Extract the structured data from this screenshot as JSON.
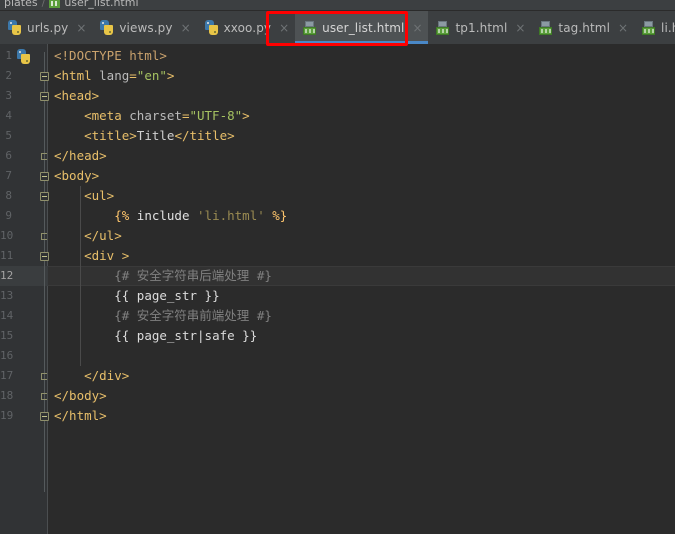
{
  "breadcrumb": {
    "path_text": "plates",
    "separator": "/",
    "file": "user_list.html",
    "file_icon": "html-file-icon"
  },
  "tabs": {
    "close_glyph": "×",
    "items": [
      {
        "label": "urls.py",
        "icon": "python-file-icon",
        "active": false
      },
      {
        "label": "views.py",
        "icon": "python-file-icon",
        "active": false
      },
      {
        "label": "xxoo.py",
        "icon": "python-file-icon",
        "active": false
      },
      {
        "label": "user_list.html",
        "icon": "html-file-icon",
        "active": true
      },
      {
        "label": "tp1.html",
        "icon": "html-file-icon",
        "active": false
      },
      {
        "label": "tag.html",
        "icon": "html-file-icon",
        "active": false
      },
      {
        "label": "li.html",
        "icon": "html-file-icon",
        "active": false
      }
    ]
  },
  "editor": {
    "active_file": "user_list.html",
    "caret_line": 12,
    "line_numbers": [
      1,
      2,
      3,
      4,
      5,
      6,
      7,
      8,
      9,
      10,
      11,
      12,
      13,
      14,
      15,
      16,
      17,
      18,
      19
    ],
    "lines": [
      {
        "num": 1,
        "text": "<!DOCTYPE html>"
      },
      {
        "num": 2,
        "text": "<html lang=\"en\">"
      },
      {
        "num": 3,
        "text": "<head>"
      },
      {
        "num": 4,
        "text": "    <meta charset=\"UTF-8\">"
      },
      {
        "num": 5,
        "text": "    <title>Title</title>"
      },
      {
        "num": 6,
        "text": "</head>"
      },
      {
        "num": 7,
        "text": "<body>"
      },
      {
        "num": 8,
        "text": "    <ul>"
      },
      {
        "num": 9,
        "text": "        {% include 'li.html' %}"
      },
      {
        "num": 10,
        "text": "    </ul>"
      },
      {
        "num": 11,
        "text": "    <div >"
      },
      {
        "num": 12,
        "text": "        {# 安全字符串后端处理 #}"
      },
      {
        "num": 13,
        "text": "        {{ page_str }}"
      },
      {
        "num": 14,
        "text": "        {# 安全字符串前端处理 #}"
      },
      {
        "num": 15,
        "text": "        {{ page_str|safe }}"
      },
      {
        "num": 16,
        "text": ""
      },
      {
        "num": 17,
        "text": "    </div>"
      },
      {
        "num": 18,
        "text": "</body>"
      },
      {
        "num": 19,
        "text": "</html>"
      }
    ]
  },
  "annotation": {
    "shape": "rectangle",
    "color": "#ff0000",
    "target": "user_list.html"
  },
  "theme": {
    "editor_bg": "#2b2b2b",
    "gutter_bg": "#313335",
    "chrome_bg": "#3c3f41",
    "active_tab_bg": "#4e5254",
    "active_tab_underline": "#4a88c7",
    "caret_line_bg": "#323232",
    "tag_color": "#e8bf6a",
    "string_color": "#a5c261",
    "django_brace_color": "#ffc66d",
    "comment_color": "#808080",
    "text_color": "#a9b7c6",
    "line_number_color": "#606366"
  }
}
